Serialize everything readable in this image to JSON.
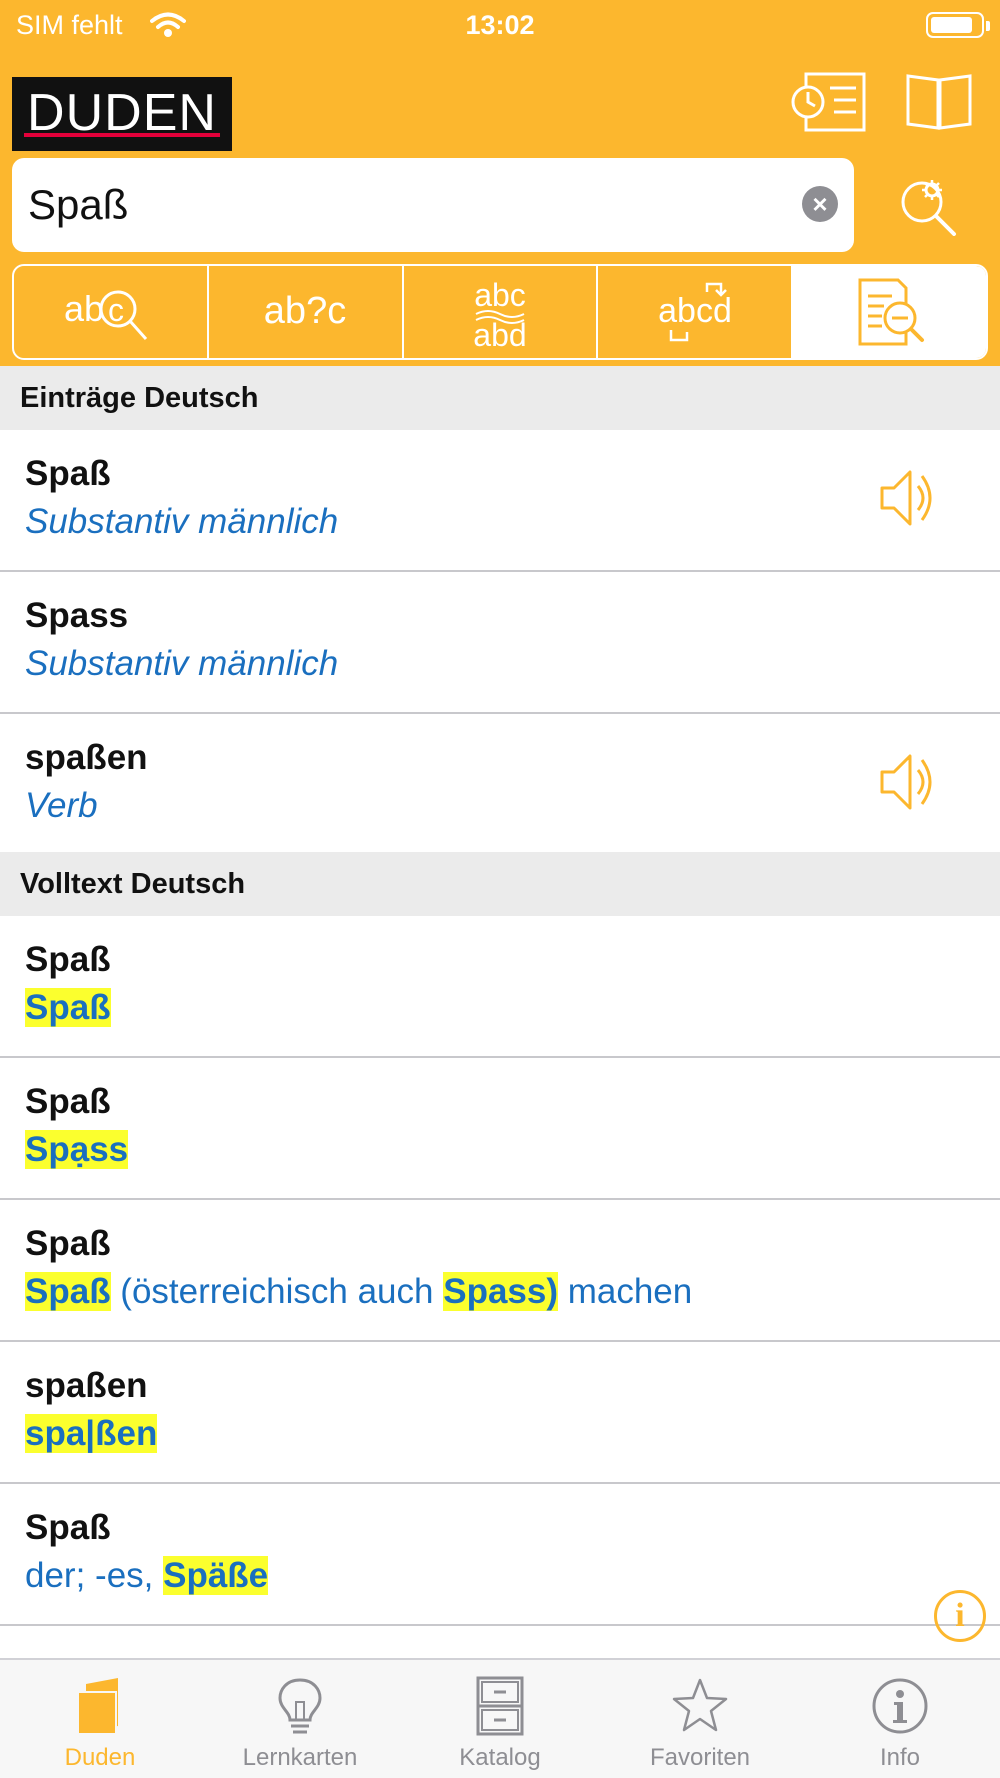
{
  "status": {
    "carrier": "SIM fehlt",
    "time": "13:02"
  },
  "header": {
    "logo": "DUDEN"
  },
  "search": {
    "value": "Spaß"
  },
  "modes": [
    {
      "label": "abc",
      "icon": "search-letter-icon"
    },
    {
      "label": "ab?c",
      "icon": "wildcard-icon"
    },
    {
      "label": "abc / abd",
      "icon": "similar-icon"
    },
    {
      "label": "abcd",
      "icon": "anagram-icon"
    },
    {
      "label": "",
      "icon": "fulltext-search-icon",
      "active": true
    }
  ],
  "sections": [
    {
      "title": "Einträge Deutsch",
      "rows": [
        {
          "title": "Spaß",
          "sub": "Substantiv männlich",
          "speaker": true
        },
        {
          "title": "Spass",
          "sub": "Substantiv männlich",
          "speaker": false
        },
        {
          "title": "spaßen",
          "sub": "Verb",
          "speaker": true
        }
      ]
    },
    {
      "title": "Volltext Deutsch",
      "rows": [
        {
          "title": "Spaß",
          "sub_parts": [
            {
              "t": "Spaß",
              "hl": true
            }
          ]
        },
        {
          "title": "Spaß",
          "sub_parts": [
            {
              "t": "Spạss",
              "hl": true
            }
          ]
        },
        {
          "title": "Spaß",
          "sub_parts": [
            {
              "t": "Spaß",
              "hl": true
            },
            {
              "t": " (österreichisch auch ",
              "hl": false
            },
            {
              "t": "Spass)",
              "hl": true
            },
            {
              "t": " machen",
              "hl": false
            }
          ]
        },
        {
          "title": "spaßen",
          "sub_parts": [
            {
              "t": "spa|ßen",
              "hl": true
            }
          ]
        },
        {
          "title": "Spaß",
          "sub_parts": [
            {
              "t": "der; -es, ",
              "hl": false
            },
            {
              "t": "Späße",
              "hl": true
            }
          ]
        }
      ]
    }
  ],
  "tabs": [
    {
      "label": "Duden",
      "active": true
    },
    {
      "label": "Lernkarten",
      "active": false
    },
    {
      "label": "Katalog",
      "active": false
    },
    {
      "label": "Favoriten",
      "active": false
    },
    {
      "label": "Info",
      "active": false
    }
  ],
  "colors": {
    "accent": "#fcb72e",
    "link": "#1a6fbf",
    "highlight": "#fbff2e"
  }
}
